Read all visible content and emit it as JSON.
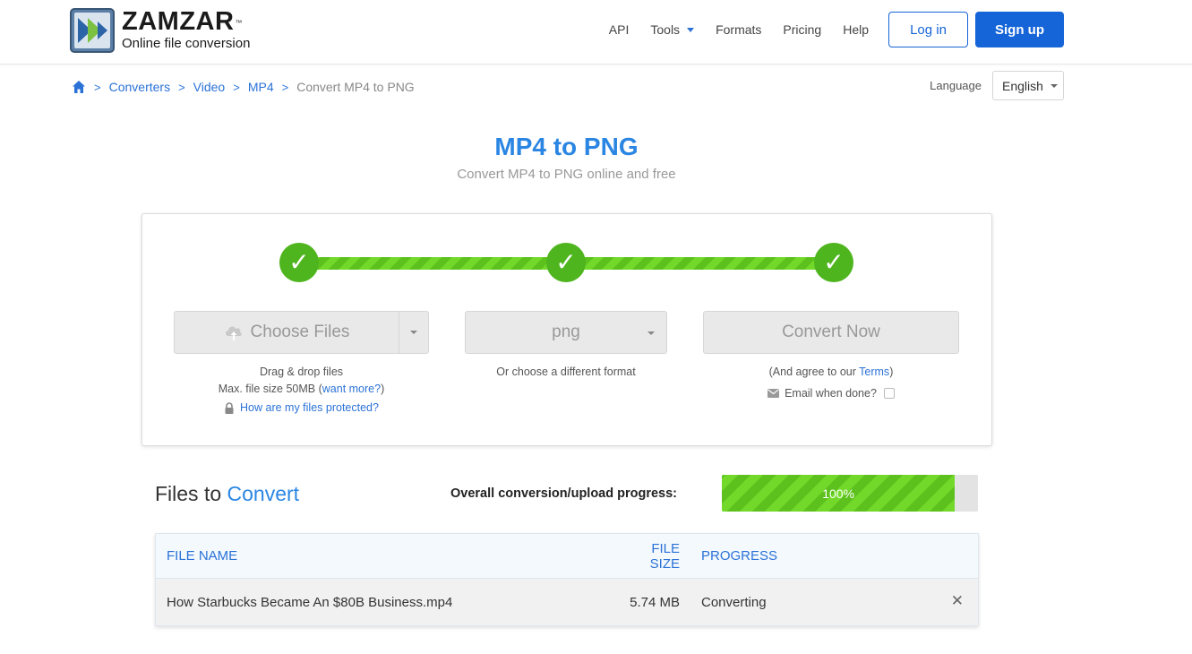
{
  "brand": {
    "name": "ZAMZAR",
    "tm": "™",
    "tagline": "Online file conversion"
  },
  "nav": {
    "items": [
      "API",
      "Tools",
      "Formats",
      "Pricing",
      "Help"
    ],
    "login": "Log in",
    "signup": "Sign up"
  },
  "breadcrumb": {
    "sep": ">",
    "items": [
      "Converters",
      "Video",
      "MP4"
    ],
    "current": "Convert MP4 to PNG"
  },
  "language": {
    "label": "Language",
    "value": "English"
  },
  "page": {
    "title": "MP4 to PNG",
    "subtitle": "Convert MP4 to PNG online and free"
  },
  "steps": {
    "check": "✓",
    "completed": 3
  },
  "choose": {
    "button": "Choose Files",
    "drag": "Drag & drop files",
    "max_size_prefix": "Max. file size 50MB (",
    "max_size_link": "want more?",
    "max_size_suffix": ")",
    "protected": "How are my files protected?"
  },
  "format": {
    "value": "png",
    "hint": "Or choose a different format"
  },
  "convert": {
    "button": "Convert Now",
    "agree_prefix": "(And agree to our ",
    "agree_link": "Terms",
    "agree_suffix": ")",
    "email_label": "Email when done?"
  },
  "files": {
    "title_part1": "Files to",
    "title_part2": "Convert",
    "overall_label": "Overall conversion/upload progress:",
    "overall_progress_text": "100%",
    "overall_progress_fraction": 0.91,
    "columns": {
      "name": "FILE NAME",
      "size": "FILE SIZE",
      "progress": "PROGRESS"
    },
    "rows": [
      {
        "name": "How Starbucks Became An $80B Business.mp4",
        "size": "5.74 MB",
        "status": "Converting",
        "remove": "✕"
      }
    ]
  },
  "colors": {
    "brand_blue": "#1565d8",
    "link_blue": "#2b72d7",
    "title_blue": "#2b86e3",
    "success_green": "#4fb51e"
  }
}
